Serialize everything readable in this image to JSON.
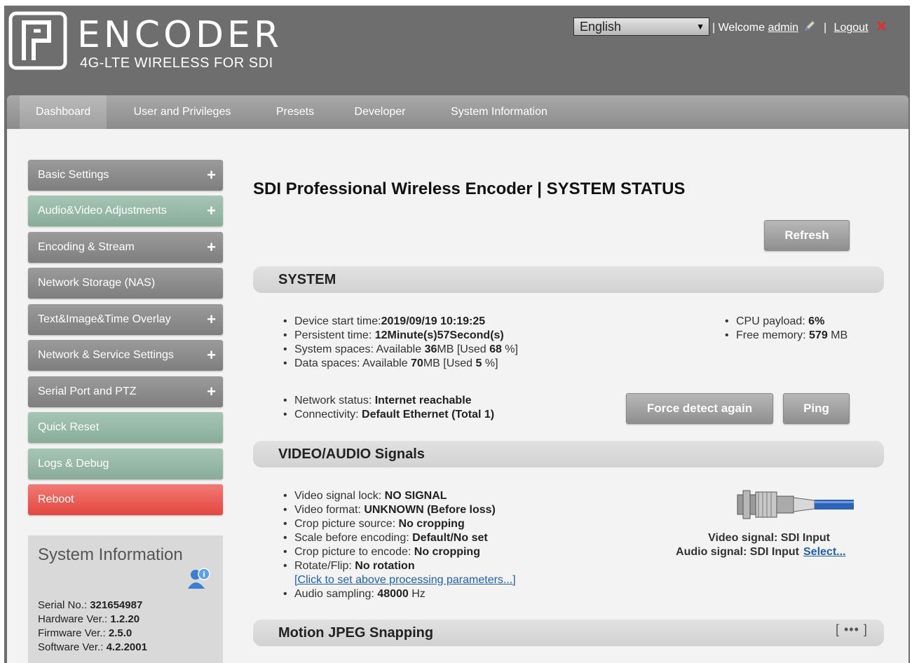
{
  "header": {
    "logo_title": "ENCODER",
    "logo_subtitle": "4G-LTE WIRELESS FOR SDI",
    "language": "English",
    "welcome_text": "| Welcome",
    "username": "admin",
    "separator": "|",
    "logout": "Logout"
  },
  "nav": {
    "tabs": [
      {
        "label": "Dashboard",
        "active": true
      },
      {
        "label": "User and Privileges"
      },
      {
        "label": "Presets"
      },
      {
        "label": "Developer"
      },
      {
        "label": "System Information"
      }
    ]
  },
  "sidebar": {
    "items": [
      {
        "label": "Basic Settings",
        "style": "gray",
        "expandable": true
      },
      {
        "label": "Audio&Video Adjustments",
        "style": "green",
        "expandable": true
      },
      {
        "label": "Encoding & Stream",
        "style": "gray",
        "expandable": true
      },
      {
        "label": "Network Storage (NAS)",
        "style": "gray",
        "expandable": false
      },
      {
        "label": "Text&Image&Time Overlay",
        "style": "gray",
        "expandable": true
      },
      {
        "label": "Network & Service Settings",
        "style": "gray",
        "expandable": true
      },
      {
        "label": "Serial Port and PTZ",
        "style": "gray",
        "expandable": true
      },
      {
        "label": "Quick Reset",
        "style": "green",
        "expandable": false
      },
      {
        "label": "Logs & Debug",
        "style": "green",
        "expandable": false
      },
      {
        "label": "Reboot",
        "style": "red",
        "expandable": false
      }
    ],
    "plus": "+",
    "system_info": {
      "title": "System Information",
      "serial_label": "Serial No.: ",
      "serial": "321654987",
      "hardware_label": "Hardware Ver.: ",
      "hardware": "1.2.20",
      "firmware_label": "Firmware Ver.: ",
      "firmware": "2.5.0",
      "software_label": "Software Ver.: ",
      "software": "4.2.2001"
    }
  },
  "main": {
    "title": "SDI Professional Wireless Encoder | SYSTEM STATUS",
    "refresh": "Refresh",
    "system": {
      "heading": "SYSTEM",
      "start_label": "Device start time:",
      "start": "2019/09/19 10:19:25",
      "persist_label": "Persistent time: ",
      "persist": "12Minute(s)57Second(s)",
      "sys_label": "System spaces: Available ",
      "sys_avail": "36",
      "sys_mid": "MB [Used ",
      "sys_used": "68",
      "sys_end": " %]",
      "data_label": "Data spaces: Available ",
      "data_avail": "70",
      "data_mid": "MB [Used ",
      "data_used": "5",
      "data_end": " %]",
      "cpu_label": "CPU payload: ",
      "cpu": "6%",
      "mem_label": "Free memory: ",
      "mem": "579",
      "mem_unit": " MB",
      "net_label": "Network status: ",
      "net": "Internet reachable",
      "conn_label": "Connectivity: ",
      "conn": "Default Ethernet (Total 1)",
      "force_detect": "Force detect again",
      "ping": "Ping"
    },
    "video": {
      "heading": "VIDEO/AUDIO Signals",
      "lock_label": "Video signal lock: ",
      "lock": "NO SIGNAL",
      "format_label": "Video format: ",
      "format": "UNKNOWN (Before loss)",
      "crop_src_label": "Crop picture source: ",
      "crop_src": "No cropping",
      "scale_label": "Scale before encoding: ",
      "scale": "Default/No set",
      "crop_enc_label": "Crop picture to encode: ",
      "crop_enc": "No cropping",
      "rotate_label": "Rotate/Flip: ",
      "rotate": "No rotation",
      "params_link": "[Click to set above processing parameters...]",
      "audio_label": "Audio sampling: ",
      "audio": "48000",
      "audio_unit": " Hz",
      "video_signal": "Video signal: SDI Input",
      "audio_signal": "Audio signal: SDI Input",
      "select": "Select..."
    },
    "mjpeg": {
      "heading": "Motion JPEG Snapping",
      "more": "[ ••• ]"
    }
  },
  "colors": {
    "header_bg": "#6e6e6e",
    "content_bg": "#f3f3f3",
    "accent_green": "#89ac99",
    "accent_red": "#e2473f",
    "link": "#1e5fae"
  }
}
